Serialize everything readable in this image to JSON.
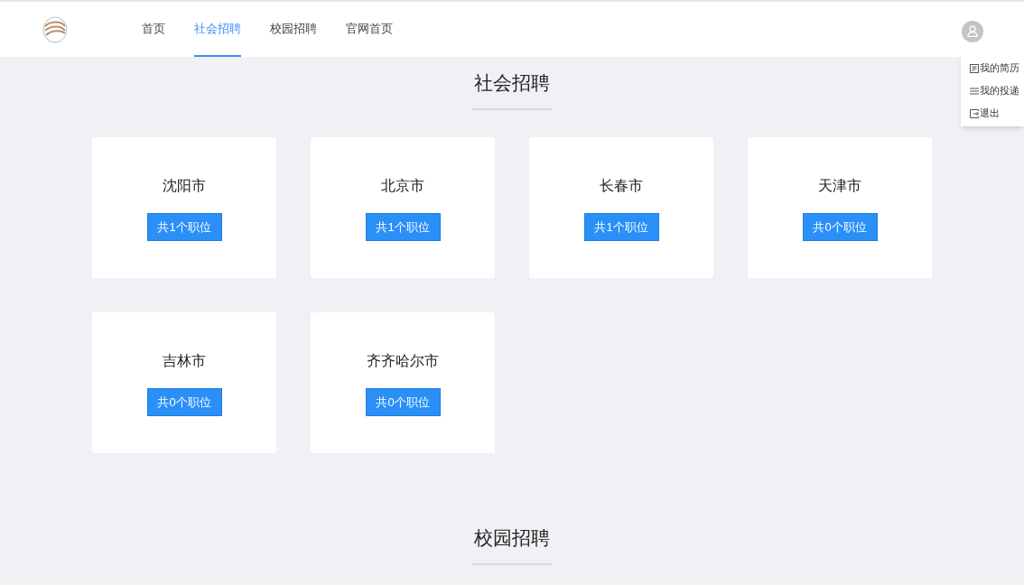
{
  "nav": [
    {
      "label": "首页",
      "selected": false
    },
    {
      "label": "社会招聘",
      "selected": true
    },
    {
      "label": "校园招聘",
      "selected": false
    },
    {
      "label": "官网首页",
      "selected": false
    }
  ],
  "user_menu": [
    {
      "kind": "resume",
      "label": "我的简历"
    },
    {
      "kind": "list",
      "label": "我的投递"
    },
    {
      "kind": "logout",
      "label": "退出"
    }
  ],
  "sections": [
    {
      "title": "社会招聘",
      "cities": [
        {
          "name": "沈阳市",
          "button": "共1个职位"
        },
        {
          "name": "北京市",
          "button": "共1个职位"
        },
        {
          "name": "长春市",
          "button": "共1个职位"
        },
        {
          "name": "天津市",
          "button": "共0个职位"
        },
        {
          "name": "吉林市",
          "button": "共0个职位"
        },
        {
          "name": "齐齐哈尔市",
          "button": "共0个职位"
        }
      ]
    },
    {
      "title": "校园招聘"
    }
  ]
}
